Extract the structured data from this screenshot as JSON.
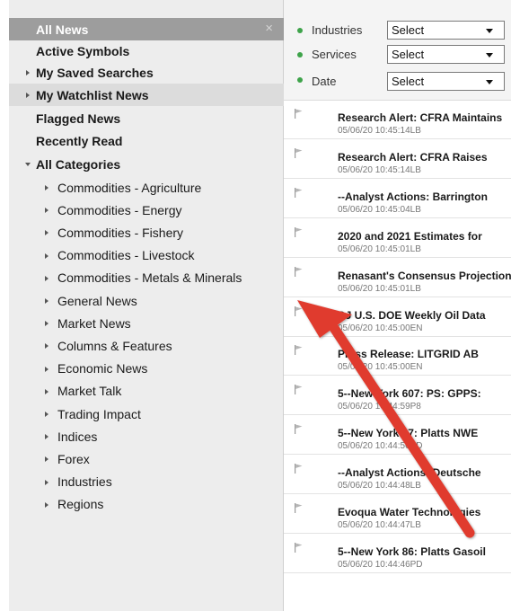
{
  "sidebar": {
    "items": [
      {
        "label": "All News",
        "type": "selected"
      },
      {
        "label": "Active Symbols",
        "type": "bold"
      },
      {
        "label": "My Saved Searches",
        "type": "bold-expandable"
      },
      {
        "label": "My Watchlist News",
        "type": "bold-expandable-highlight"
      },
      {
        "label": "Flagged News",
        "type": "bold"
      },
      {
        "label": "Recently Read",
        "type": "bold"
      },
      {
        "label": "All Categories",
        "type": "bold-expanded"
      }
    ],
    "categories": [
      "Commodities - Agriculture",
      "Commodities - Energy",
      "Commodities - Fishery",
      "Commodities - Livestock",
      "Commodities - Metals & Minerals",
      "General News",
      "Market News",
      "Columns & Features",
      "Economic News",
      "Market Talk",
      "Trading Impact",
      "Indices",
      "Forex",
      "Industries",
      "Regions"
    ],
    "close_glyph": "×"
  },
  "filters": [
    {
      "label": "Industries",
      "value": "Select"
    },
    {
      "label": "Services",
      "value": "Select"
    },
    {
      "label": "Date",
      "value": "Select"
    }
  ],
  "news": [
    {
      "title": "Research Alert: CFRA Maintains",
      "meta": "05/06/20 10:45:14LB"
    },
    {
      "title": "Research Alert: CFRA Raises",
      "meta": "05/06/20 10:45:14LB"
    },
    {
      "title": "--Analyst Actions: Barrington",
      "meta": "05/06/20 10:45:04LB"
    },
    {
      "title": "2020 and 2021 Estimates for",
      "meta": "05/06/20 10:45:01LB"
    },
    {
      "title": "Renasant's Consensus Projections",
      "meta": "05/06/20 10:45:01LB"
    },
    {
      "title": "DJ U.S. DOE Weekly Oil Data",
      "meta": "05/06/20 10:45:00EN"
    },
    {
      "title": "Press Release: LITGRID AB",
      "meta": "05/06/20 10:45:00EN"
    },
    {
      "title": "5--New York 607: PS: GPPS:",
      "meta": "05/06/20 10:44:59P8"
    },
    {
      "title": "5--New York 87: Platts NWE",
      "meta": "05/06/20 10:44:50PD"
    },
    {
      "title": "--Analyst Actions: Deutsche",
      "meta": "05/06/20 10:44:48LB"
    },
    {
      "title": "Evoqua Water Technologies",
      "meta": "05/06/20 10:44:47LB"
    },
    {
      "title": "5--New York 86: Platts Gasoil",
      "meta": "05/06/20 10:44:46PD"
    }
  ],
  "colors": {
    "selected_bg": "#9d9d9d",
    "sidebar_bg": "#ededed",
    "filter_dot": "#3ea34a",
    "annotation_arrow": "#e03b2f"
  }
}
